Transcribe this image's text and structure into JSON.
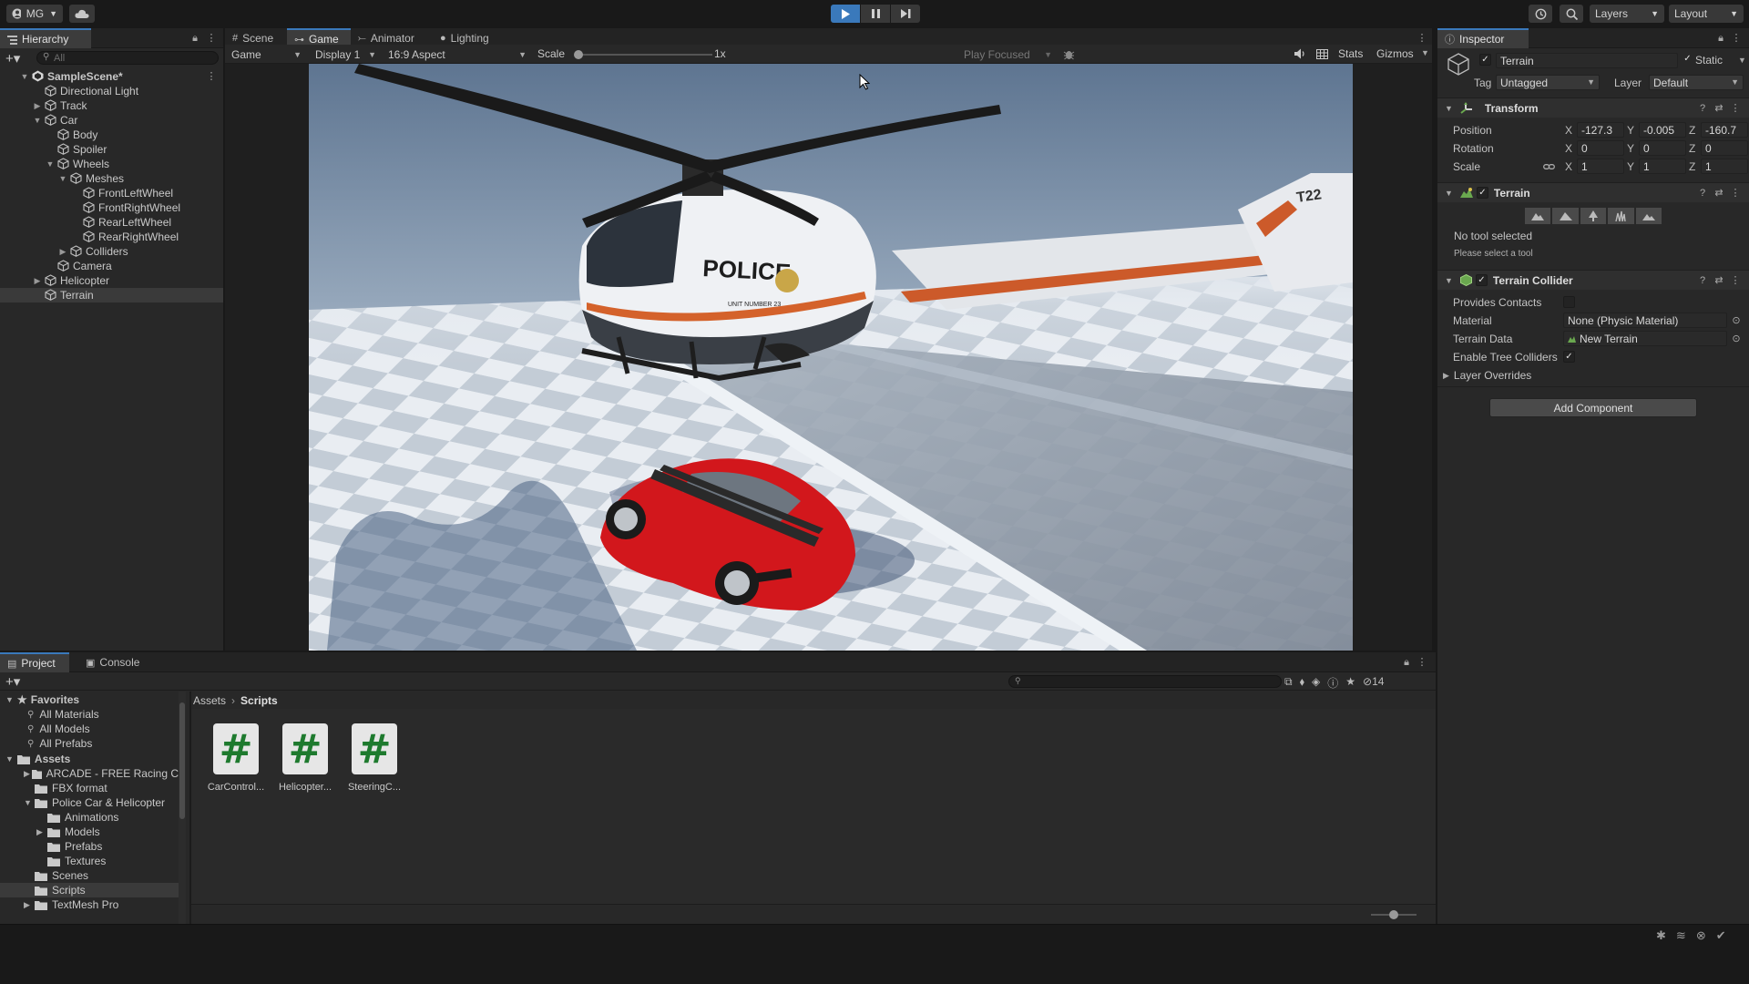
{
  "toolbar": {
    "account": "MG",
    "layers_label": "Layers",
    "layout_label": "Layout"
  },
  "hierarchy": {
    "tab": "Hierarchy",
    "search_placeholder": "All",
    "items": [
      {
        "label": "SampleScene*",
        "depth": 0,
        "arrow": "open",
        "kind": "scene"
      },
      {
        "label": "Directional Light",
        "depth": 1,
        "arrow": "none",
        "kind": "obj"
      },
      {
        "label": "Track",
        "depth": 1,
        "arrow": "closed",
        "kind": "obj"
      },
      {
        "label": "Car",
        "depth": 1,
        "arrow": "open",
        "kind": "obj"
      },
      {
        "label": "Body",
        "depth": 2,
        "arrow": "none",
        "kind": "obj"
      },
      {
        "label": "Spoiler",
        "depth": 2,
        "arrow": "none",
        "kind": "obj"
      },
      {
        "label": "Wheels",
        "depth": 2,
        "arrow": "open",
        "kind": "obj"
      },
      {
        "label": "Meshes",
        "depth": 3,
        "arrow": "open",
        "kind": "obj"
      },
      {
        "label": "FrontLeftWheel",
        "depth": 4,
        "arrow": "none",
        "kind": "obj"
      },
      {
        "label": "FrontRightWheel",
        "depth": 4,
        "arrow": "none",
        "kind": "obj"
      },
      {
        "label": "RearLeftWheel",
        "depth": 4,
        "arrow": "none",
        "kind": "obj"
      },
      {
        "label": "RearRightWheel",
        "depth": 4,
        "arrow": "none",
        "kind": "obj"
      },
      {
        "label": "Colliders",
        "depth": 3,
        "arrow": "closed",
        "kind": "obj"
      },
      {
        "label": "Camera",
        "depth": 2,
        "arrow": "none",
        "kind": "obj"
      },
      {
        "label": "Helicopter",
        "depth": 1,
        "arrow": "closed",
        "kind": "obj"
      },
      {
        "label": "Terrain",
        "depth": 1,
        "arrow": "none",
        "kind": "obj",
        "selected": true
      }
    ]
  },
  "center_tabs": [
    {
      "label": "Scene",
      "icon": "grid-icon"
    },
    {
      "label": "Game",
      "icon": "gamepad-icon",
      "active": true
    },
    {
      "label": "Animator",
      "icon": "animator-icon"
    },
    {
      "label": "Lighting",
      "icon": "bulb-icon"
    }
  ],
  "game_bar": {
    "view_mode": "Game",
    "display": "Display 1",
    "aspect": "16:9 Aspect",
    "scale_label": "Scale",
    "scale_value": "1x",
    "play_mode": "Play Focused",
    "stats": "Stats",
    "gizmos": "Gizmos"
  },
  "viewport": {
    "helicopter_text": "POLICE",
    "helicopter_tail": "T22",
    "helicopter_unit": "UNIT NUMBER 23"
  },
  "inspector": {
    "tab": "Inspector",
    "object_name": "Terrain",
    "static_label": "Static",
    "tag_label": "Tag",
    "tag_value": "Untagged",
    "layer_label": "Layer",
    "layer_value": "Default",
    "transform": {
      "title": "Transform",
      "position_label": "Position",
      "rotation_label": "Rotation",
      "scale_label": "Scale",
      "position": {
        "x": "-127.3",
        "y": "-0.005",
        "z": "-160.7"
      },
      "rotation": {
        "x": "0",
        "y": "0",
        "z": "0"
      },
      "scale": {
        "x": "1",
        "y": "1",
        "z": "1"
      }
    },
    "terrain": {
      "title": "Terrain",
      "no_tool": "No tool selected",
      "hint": "Please select a tool"
    },
    "collider": {
      "title": "Terrain Collider",
      "provides_contacts": "Provides Contacts",
      "material_label": "Material",
      "material_value": "None (Physic Material)",
      "terrain_data_label": "Terrain Data",
      "terrain_data_value": "New Terrain",
      "tree_colliders_label": "Enable Tree Colliders",
      "layer_overrides": "Layer Overrides"
    },
    "add_component": "Add Component"
  },
  "project": {
    "tabs": [
      {
        "label": "Project",
        "active": true
      },
      {
        "label": "Console"
      }
    ],
    "favorites_label": "Favorites",
    "favorites": [
      "All Materials",
      "All Models",
      "All Prefabs"
    ],
    "assets_label": "Assets",
    "tree": [
      {
        "label": "ARCADE - FREE Racing C",
        "depth": 1,
        "arrow": "closed"
      },
      {
        "label": "FBX format",
        "depth": 1,
        "arrow": "none"
      },
      {
        "label": "Police Car & Helicopter",
        "depth": 1,
        "arrow": "open"
      },
      {
        "label": "Animations",
        "depth": 2,
        "arrow": "none"
      },
      {
        "label": "Models",
        "depth": 2,
        "arrow": "closed"
      },
      {
        "label": "Prefabs",
        "depth": 2,
        "arrow": "none"
      },
      {
        "label": "Textures",
        "depth": 2,
        "arrow": "none"
      },
      {
        "label": "Scenes",
        "depth": 1,
        "arrow": "none"
      },
      {
        "label": "Scripts",
        "depth": 1,
        "arrow": "none",
        "selected": true
      },
      {
        "label": "TextMesh Pro",
        "depth": 1,
        "arrow": "closed"
      }
    ],
    "breadcrumb": [
      "Assets",
      "Scripts"
    ],
    "hidden_count": "14",
    "files": [
      "CarControl...",
      "Helicopter...",
      "SteeringC..."
    ]
  }
}
